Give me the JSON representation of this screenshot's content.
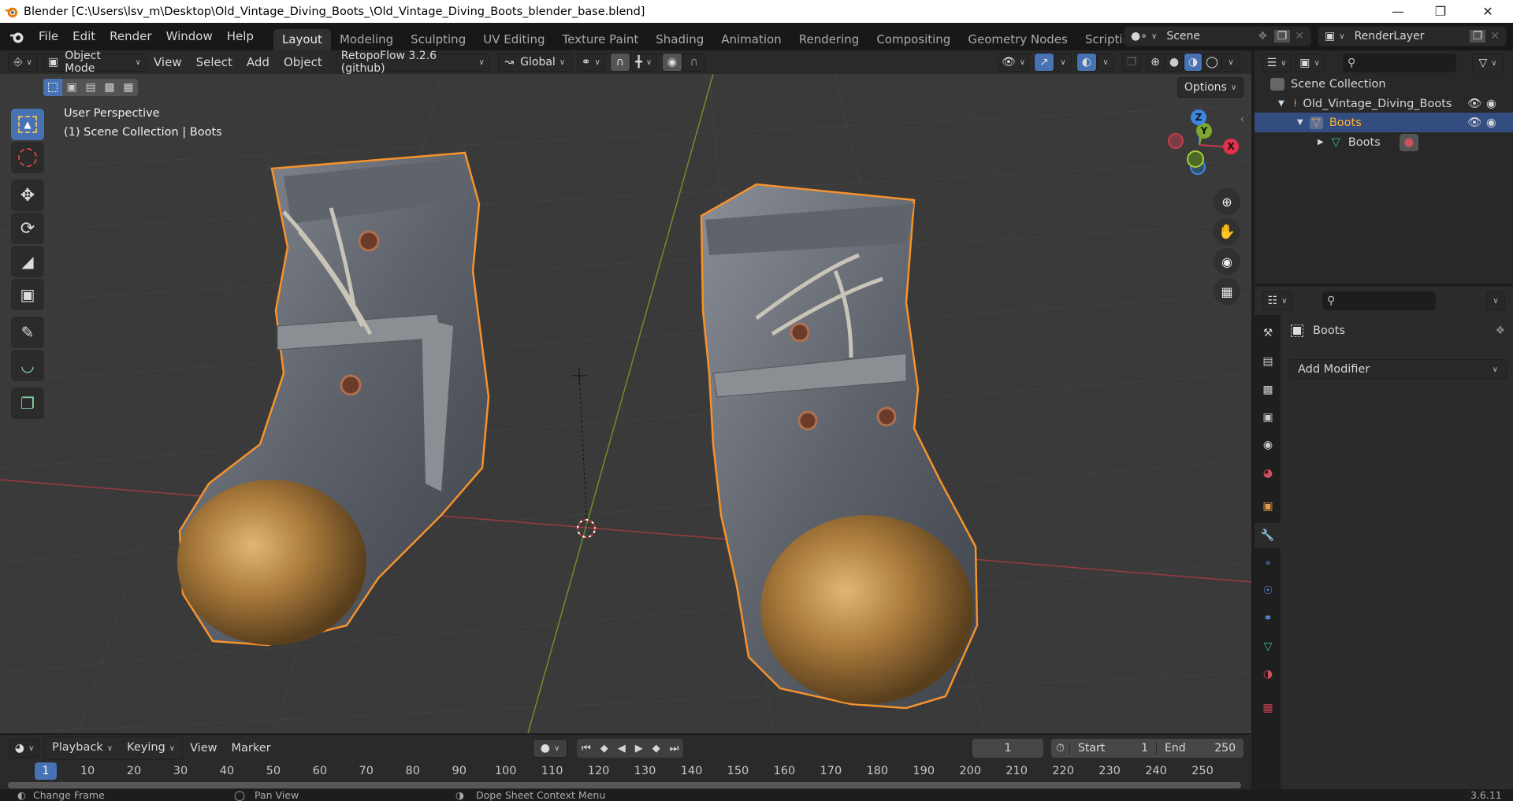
{
  "window": {
    "title": "Blender [C:\\Users\\lsv_m\\Desktop\\Old_Vintage_Diving_Boots_\\Old_Vintage_Diving_Boots_blender_base.blend]",
    "controls": [
      "minimize",
      "maximize",
      "close"
    ]
  },
  "menu": {
    "items": [
      "File",
      "Edit",
      "Render",
      "Window",
      "Help"
    ]
  },
  "workspaces": {
    "active": "Layout",
    "tabs": [
      "Layout",
      "Modeling",
      "Sculpting",
      "UV Editing",
      "Texture Paint",
      "Shading",
      "Animation",
      "Rendering",
      "Compositing",
      "Geometry Nodes",
      "Scripting"
    ],
    "add_label": "+"
  },
  "scene_selector": {
    "value": "Scene"
  },
  "view_layer_selector": {
    "value": "RenderLayer"
  },
  "viewport_header": {
    "mode": "Object Mode",
    "menus": [
      "View",
      "Select",
      "Add",
      "Object"
    ],
    "addon": "RetopoFlow 3.2.6 (github)",
    "orientation": "Global",
    "options_label": "Options",
    "shading_active": "material-preview"
  },
  "viewport": {
    "perspective_label": "User Perspective",
    "collection_label": "(1) Scene Collection | Boots",
    "gizmo_axes": [
      "Z",
      "Y",
      "X"
    ],
    "tools": [
      "select-box",
      "cursor",
      "move",
      "rotate",
      "scale",
      "transform",
      "annotate",
      "measure",
      "add-cube"
    ],
    "active_tool": "select-box",
    "colors": {
      "selection_outline": "#f7922b",
      "x_axis": "#c63c4a",
      "y_axis": "#7da82d",
      "z_axis": "#3b86e0"
    }
  },
  "outliner": {
    "search_placeholder": "",
    "items": [
      {
        "label": "Scene Collection",
        "depth": 0,
        "type": "scene-collection"
      },
      {
        "label": "Old_Vintage_Diving_Boots",
        "depth": 1,
        "type": "collection",
        "expanded": true
      },
      {
        "label": "Boots",
        "depth": 2,
        "type": "object",
        "selected": true,
        "expanded": true
      },
      {
        "label": "Boots",
        "depth": 3,
        "type": "mesh",
        "expanded": false
      }
    ]
  },
  "properties": {
    "object_name": "Boots",
    "add_modifier_label": "Add Modifier",
    "active_tab": "modifiers",
    "tabs": [
      "tool",
      "render",
      "output",
      "view-layer",
      "scene",
      "world",
      "object",
      "modifiers",
      "particles",
      "physics",
      "constraints",
      "data",
      "material",
      "texture"
    ]
  },
  "timeline": {
    "menus": [
      "Playback",
      "Keying",
      "View",
      "Marker"
    ],
    "current_frame": "1",
    "start_label": "Start",
    "start": "1",
    "end_label": "End",
    "end": "250",
    "ruler": [
      "1",
      "10",
      "20",
      "30",
      "40",
      "50",
      "60",
      "70",
      "80",
      "90",
      "100",
      "110",
      "120",
      "130",
      "140",
      "150",
      "160",
      "170",
      "180",
      "190",
      "200",
      "210",
      "220",
      "230",
      "240",
      "250"
    ]
  },
  "statusbar": {
    "hints": [
      "Change Frame",
      "Pan View",
      "Dope Sheet Context Menu"
    ],
    "version": "3.6.11"
  }
}
